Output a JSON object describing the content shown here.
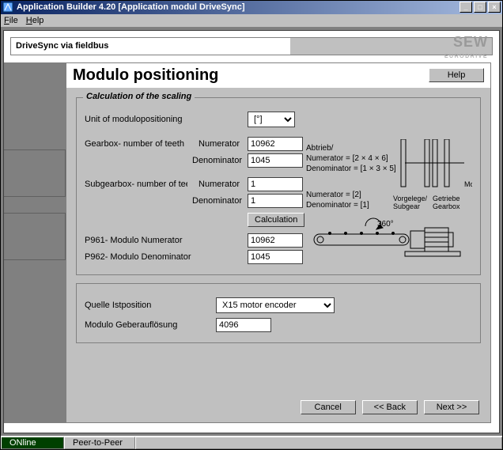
{
  "titlebar": {
    "title": "Application Builder  4.20 [Application modul DriveSync]"
  },
  "menubar": {
    "file": "File",
    "help": "Help"
  },
  "header": {
    "title": "DriveSync via fieldbus",
    "brand": "SEW",
    "brand_sub": "EURODRIVE"
  },
  "page": {
    "heading": "Modulo positioning",
    "help_btn": "Help"
  },
  "group_scaling": {
    "legend": "Calculation of the scaling",
    "unit_label": "Unit of modulopositioning",
    "unit_value": "[°]",
    "gearbox_label": "Gearbox- number of teeth",
    "numerator_label": "Numerator",
    "denominator_label": "Denominator",
    "gearbox_num": "10962",
    "gearbox_den": "1045",
    "subgearbox_label": "Subgearbox- number of teeth",
    "sub_num": "1",
    "sub_den": "1",
    "calc_btn": "Calculation",
    "p961_label": "P961- Modulo Numerator",
    "p962_label": "P962- Modulo Denominator",
    "p961_val": "10962",
    "p962_val": "1045",
    "abtrieb": "Abtrieb/",
    "formula_num": "Numerator = [2 × 4 × 6]",
    "formula_den": "Denominator = [1 × 3 × 5]",
    "formula_num2": "Numerator = [2]",
    "formula_den2": "Denominator = [1]",
    "angle": "360°",
    "dia_subgear": "Vorgelege/\nSubgear",
    "dia_gearbox": "Getriebe\nGearbox",
    "dia_motor": "Motor"
  },
  "group_source": {
    "quelle_label": "Quelle Istposition",
    "quelle_value": "X15 motor encoder",
    "res_label": "Modulo Geberauflösung",
    "res_value": "4096"
  },
  "wizard": {
    "cancel": "Cancel",
    "back": "<< Back",
    "next": "Next >>"
  },
  "status": {
    "online": "ONline",
    "mode": "Peer-to-Peer"
  }
}
